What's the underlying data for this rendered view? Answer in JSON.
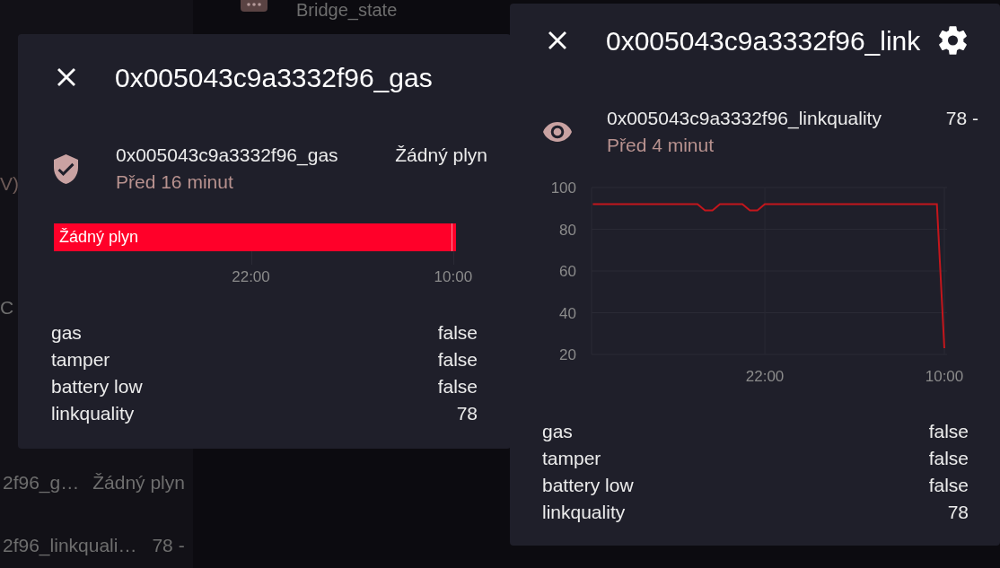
{
  "background": {
    "header": {
      "title": "Bridge_state"
    },
    "fragments": [
      "V)",
      "C"
    ],
    "rows": [
      {
        "name": "2f96_g…",
        "state": "Žádný plyn"
      },
      {
        "name": "2f96_linkquali…",
        "state": "78 -"
      }
    ]
  },
  "dialogs": [
    {
      "kind": "binary_sensor",
      "title": "0x005043c9a3332f96_gas",
      "entity": {
        "name": "0x005043c9a3332f96_gas",
        "state": "Žádný plyn",
        "last_changed": "Před 16 minut"
      },
      "timeline": {
        "segments": [
          {
            "label": "Žádný plyn",
            "color": "#ff0029"
          }
        ],
        "ticks": [
          "22:00",
          "10:00"
        ]
      },
      "attributes": [
        {
          "name": "gas",
          "value": "false"
        },
        {
          "name": "tamper",
          "value": "false"
        },
        {
          "name": "battery low",
          "value": "false"
        },
        {
          "name": "linkquality",
          "value": "78"
        }
      ]
    },
    {
      "kind": "sensor",
      "title": "0x005043c9a3332f96_link",
      "entity": {
        "name": "0x005043c9a3332f96_linkquality",
        "state": "78 -",
        "last_changed": "Před 4 minut"
      },
      "chart_data": {
        "type": "line",
        "categories": [
          null,
          null,
          null,
          null,
          null,
          null,
          null,
          null,
          null,
          null,
          null,
          null,
          null,
          null,
          null,
          null,
          null,
          null,
          null,
          null,
          null,
          null,
          null,
          "22:00",
          null,
          null,
          null,
          null,
          null,
          null,
          null,
          null,
          null,
          null,
          null,
          null,
          null,
          null,
          null,
          null,
          null,
          null,
          null,
          null,
          null,
          null,
          null,
          "10:00"
        ],
        "series": [
          {
            "color": "#c4161c",
            "values": [
              92,
              92,
              92,
              92,
              92,
              92,
              92,
              92,
              92,
              92,
              92,
              92,
              92,
              92,
              92,
              89,
              89,
              92,
              92,
              92,
              92,
              89,
              89,
              92,
              92,
              92,
              92,
              92,
              92,
              92,
              92,
              92,
              92,
              92,
              92,
              92,
              92,
              92,
              92,
              92,
              92,
              92,
              92,
              92,
              92,
              92,
              92,
              23
            ]
          }
        ],
        "ylim": [
          20,
          100
        ],
        "yticks": [
          20,
          40,
          60,
          80,
          100
        ]
      },
      "attributes": [
        {
          "name": "gas",
          "value": "false"
        },
        {
          "name": "tamper",
          "value": "false"
        },
        {
          "name": "battery low",
          "value": "false"
        },
        {
          "name": "linkquality",
          "value": "78"
        }
      ]
    }
  ]
}
